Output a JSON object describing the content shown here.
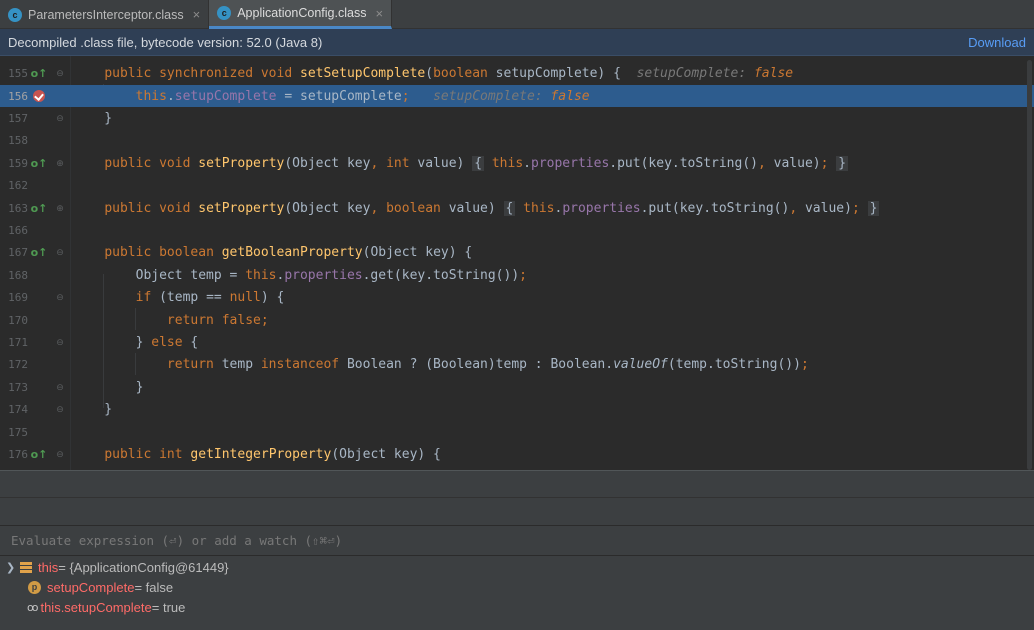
{
  "tabs": [
    {
      "label": "ParametersInterceptor.class",
      "icon": "class-icon",
      "close": "×"
    },
    {
      "label": "ApplicationConfig.class",
      "icon": "class-icon",
      "close": "×"
    }
  ],
  "banner": {
    "text": "Decompiled .class file, bytecode version: 52.0 (Java 8)",
    "link": "Download"
  },
  "editor": {
    "lines": [
      {
        "n": "155"
      },
      {
        "n": "156"
      },
      {
        "n": "157"
      },
      {
        "n": "158"
      },
      {
        "n": "159"
      },
      {
        "n": "162"
      },
      {
        "n": "163"
      },
      {
        "n": "166"
      },
      {
        "n": "167"
      },
      {
        "n": "168"
      },
      {
        "n": "169"
      },
      {
        "n": "170"
      },
      {
        "n": "171"
      },
      {
        "n": "172"
      },
      {
        "n": "173"
      },
      {
        "n": "174"
      },
      {
        "n": "175"
      },
      {
        "n": "176"
      }
    ],
    "tok": {
      "public": "public",
      "synchronized": "synchronized",
      "void": "void",
      "boolean": "boolean",
      "int": "int",
      "this": "this",
      "if": "if",
      "null": "null",
      "return": "return",
      "false": "false",
      "else": "else",
      "instanceof": "instanceof",
      "setSetupComplete": "setSetupComplete",
      "setProperty": "setProperty",
      "getBooleanProperty": "getBooleanProperty",
      "getIntegerProperty": "getIntegerProperty",
      "setupComplete_field": "setupComplete",
      "properties": "properties",
      "valueOf": "valueOf",
      "hint_name": "setupComplete:",
      "hint_value": "false"
    }
  },
  "evaluate": {
    "placeholder": "Evaluate expression (⏎) or add a watch (⇧⌘⏎)"
  },
  "variables": [
    {
      "name": "this",
      "value": " = {ApplicationConfig@61449}",
      "icon": "object-icon"
    },
    {
      "name": "setupComplete",
      "value": " = false",
      "icon": "parameter-icon"
    },
    {
      "name": "this.setupComplete",
      "value": " = true",
      "icon": "watch-icon"
    }
  ],
  "colors": {
    "keyword": "#cc7832",
    "method": "#ffc66d",
    "field": "#9876aa",
    "highlight": "#2d5c8e",
    "link": "#589df6"
  }
}
